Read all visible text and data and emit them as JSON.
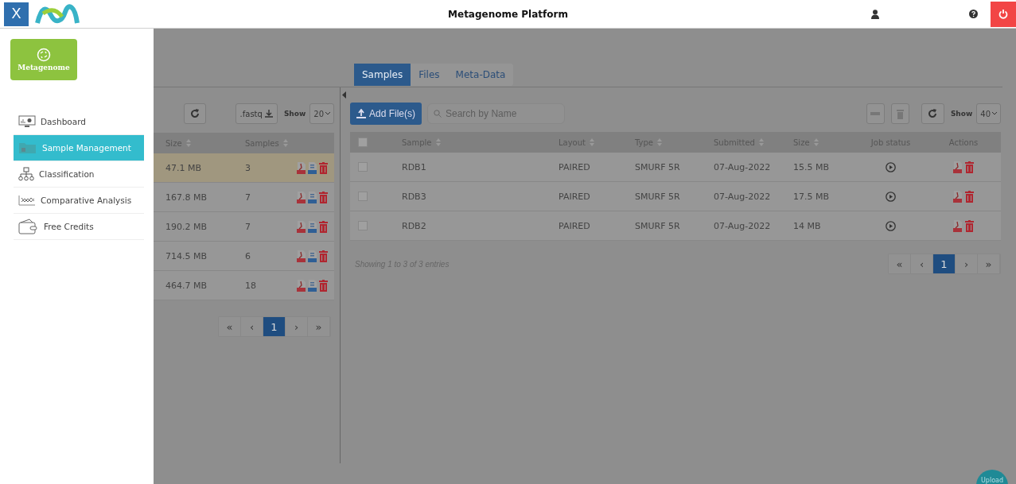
{
  "header": {
    "close_label": "X",
    "title": "Metagenome Platform"
  },
  "sidebar": {
    "logo_label": "Metagenome",
    "items": [
      {
        "label": "Dashboard",
        "selected": false
      },
      {
        "label": "Sample Management",
        "selected": true
      },
      {
        "label": "Classification",
        "selected": false
      },
      {
        "label": "Comparative Analysis",
        "selected": false
      },
      {
        "label": "Free Credits",
        "selected": false
      }
    ]
  },
  "tabs": [
    {
      "label": "Samples",
      "selected": true
    },
    {
      "label": "Files",
      "selected": false
    },
    {
      "label": "Meta-Data",
      "selected": false
    }
  ],
  "left_panel": {
    "export_label": ".fastq",
    "show_label": "Show",
    "page_size": "20",
    "columns": [
      "Size",
      "Samples"
    ],
    "rows": [
      {
        "size": "47.1 MB",
        "samples": "3",
        "selected": true
      },
      {
        "size": "167.8 MB",
        "samples": "7",
        "selected": false
      },
      {
        "size": "190.2 MB",
        "samples": "7",
        "selected": false
      },
      {
        "size": "714.5 MB",
        "samples": "6",
        "selected": false
      },
      {
        "size": "464.7 MB",
        "samples": "18",
        "selected": false
      }
    ],
    "pagination": [
      {
        "label": "«",
        "selected": false
      },
      {
        "label": "‹",
        "selected": false
      },
      {
        "label": "1",
        "selected": true
      },
      {
        "label": "›",
        "selected": false
      },
      {
        "label": "»",
        "selected": false
      }
    ]
  },
  "right_panel": {
    "add_label": "Add File(s)",
    "search": {
      "placeholder": "Search by Name"
    },
    "show_label": "Show",
    "page_size": "40",
    "select_all": {
      "checked": false
    },
    "columns": [
      "Sample",
      "Layout",
      "Type",
      "Submitted",
      "Size",
      "Job status",
      "Actions"
    ],
    "rows": [
      {
        "checked": false,
        "sample": "RDB1",
        "layout": "PAIRED",
        "type": "SMURF 5R",
        "submitted": "07-Aug-2022",
        "size": "15.5 MB"
      },
      {
        "checked": false,
        "sample": "RDB3",
        "layout": "PAIRED",
        "type": "SMURF 5R",
        "submitted": "07-Aug-2022",
        "size": "17.5 MB"
      },
      {
        "checked": false,
        "sample": "RDB2",
        "layout": "PAIRED",
        "type": "SMURF 5R",
        "submitted": "07-Aug-2022",
        "size": "14 MB"
      }
    ],
    "info": "Showing 1 to 3 of 3 entries",
    "pagination": [
      {
        "label": "«",
        "selected": false
      },
      {
        "label": "‹",
        "selected": false
      },
      {
        "label": "1",
        "selected": true
      },
      {
        "label": "›",
        "selected": false
      },
      {
        "label": "»",
        "selected": false
      }
    ]
  },
  "upload_label": "Upload"
}
